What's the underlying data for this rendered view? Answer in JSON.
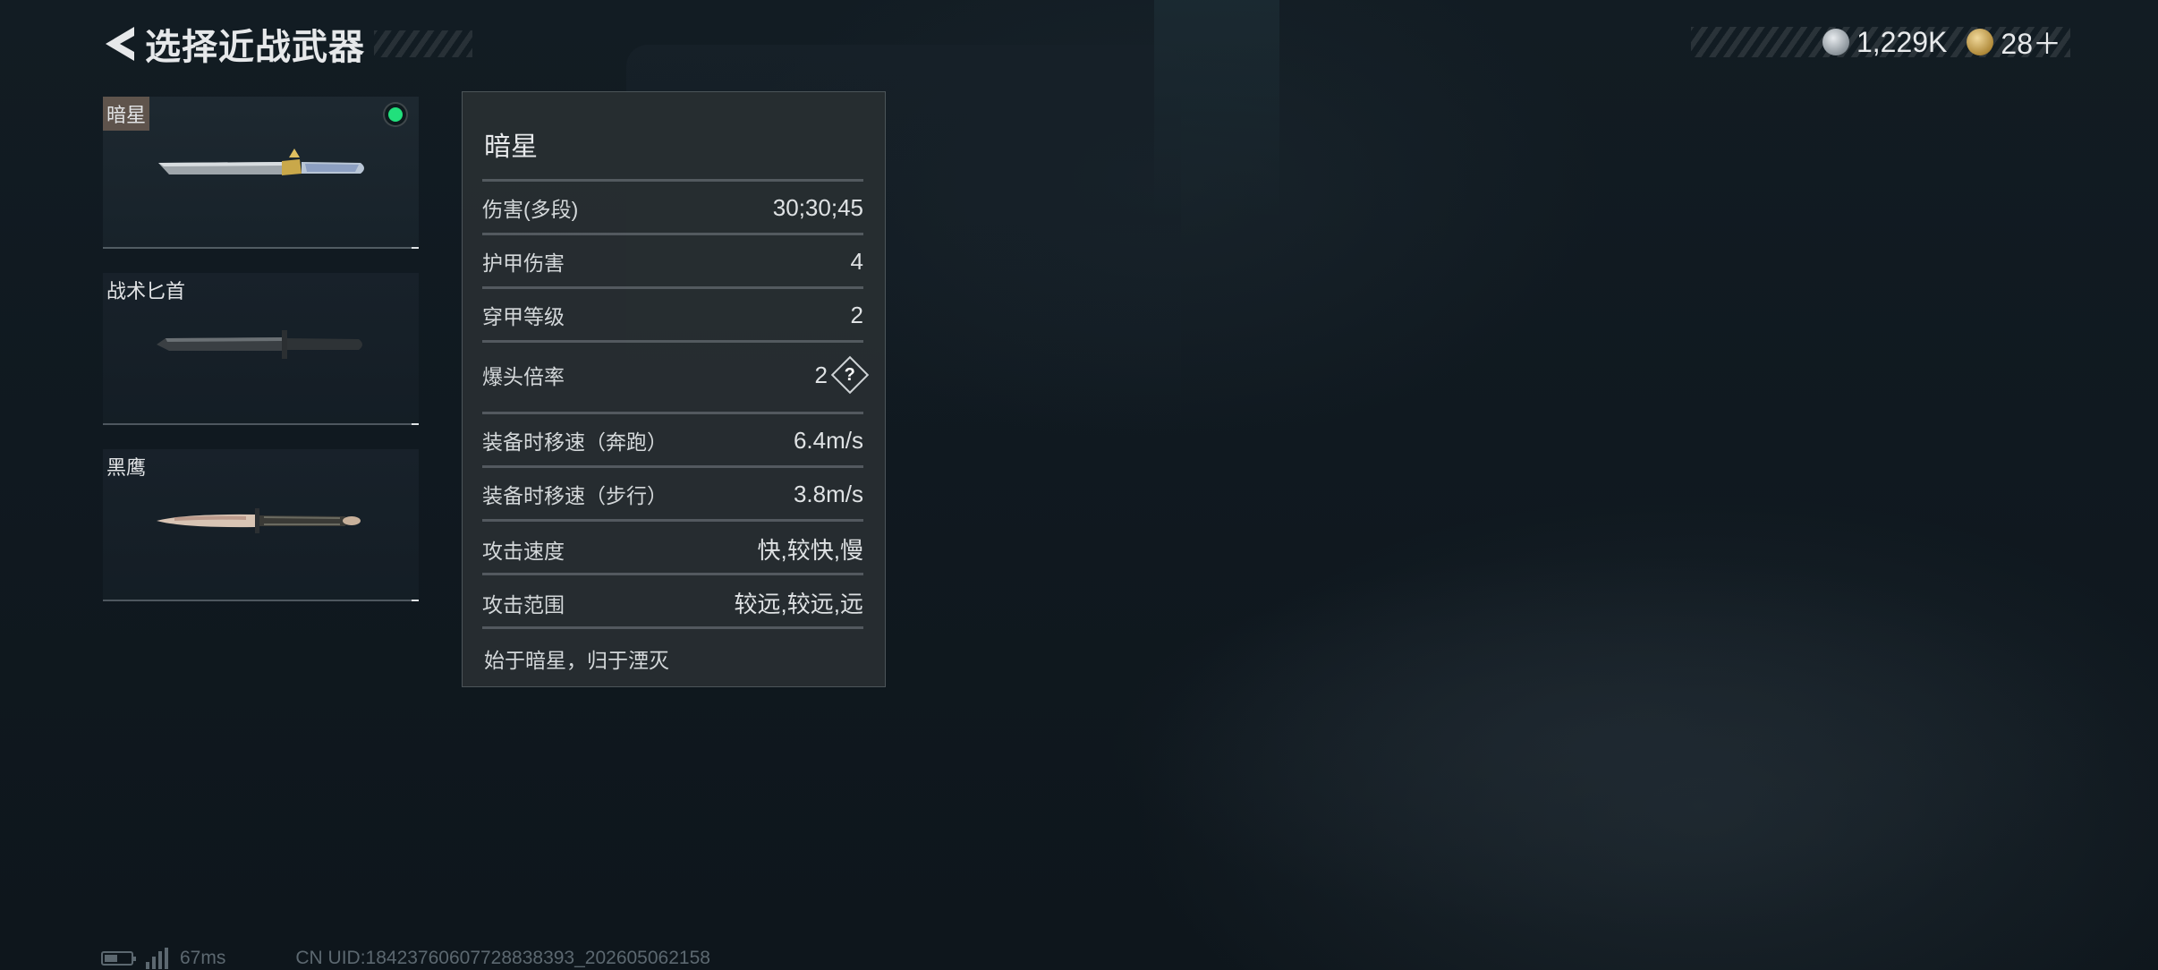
{
  "header": {
    "title": "选择近战武器",
    "back_icon": "back-arrow-icon"
  },
  "currency": [
    {
      "icon": "silver-coin-icon",
      "value": "1,229K"
    },
    {
      "icon": "gold-coin-icon",
      "value": "28＋"
    }
  ],
  "weapons": [
    {
      "name": "暗星",
      "selected": true,
      "equipped": true
    },
    {
      "name": "战术匕首",
      "selected": false,
      "equipped": false
    },
    {
      "name": "黑鹰",
      "selected": false,
      "equipped": false
    }
  ],
  "detail": {
    "title": "暗星",
    "stats": [
      {
        "label": "伤害(多段)",
        "value": "30;30;45"
      },
      {
        "label": "护甲伤害",
        "value": "4"
      },
      {
        "label": "穿甲等级",
        "value": "2"
      },
      {
        "label": "爆头倍率",
        "value": "2"
      },
      {
        "label": "装备时移速（奔跑）",
        "value": "6.4m/s"
      },
      {
        "label": "装备时移速（步行）",
        "value": "3.8m/s"
      },
      {
        "label": "攻击速度",
        "value": "快,较快,慢"
      },
      {
        "label": "攻击范围",
        "value": "较远,较远,远"
      }
    ],
    "help_label": "?",
    "description": "始于暗星，归于湮灭"
  },
  "footer": {
    "ping": "67ms",
    "uid": "CN UID:18423760607728838393_202605062158"
  },
  "colors": {
    "equipped": "#21e07c",
    "panel": "#2a2f33",
    "background": "#101920"
  }
}
